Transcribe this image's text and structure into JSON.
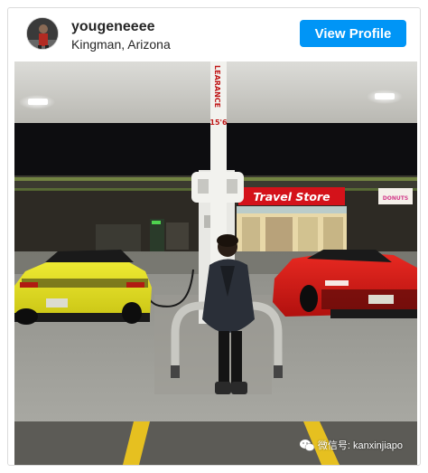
{
  "post": {
    "username": "yougeneeee",
    "location": "Kingman, Arizona",
    "view_profile_label": "View Profile"
  },
  "photo": {
    "clearance_sign": "LEARANCE 15'6\"",
    "clearance_text": "LEARANCE",
    "clearance_height": "15'6",
    "store_sign": "Travel Store",
    "donut_sign": "DONUTS"
  },
  "watermark": {
    "text": "微信号: kanxinjiapo",
    "icon": "wechat-icon"
  },
  "colors": {
    "button": "#0095f6",
    "store_sign": "#d4121a",
    "yellow_car": "#e5e21a",
    "red_car": "#d81a16"
  }
}
